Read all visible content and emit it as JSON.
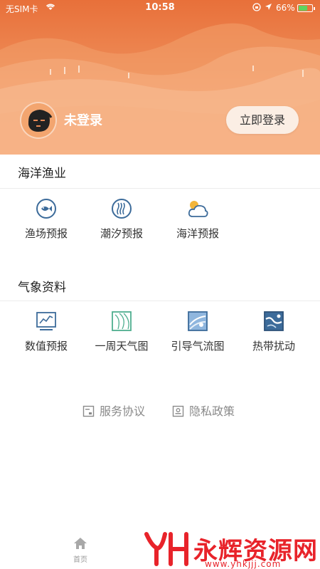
{
  "status_bar": {
    "carrier": "无SIM卡",
    "time": "10:58",
    "battery": "66%",
    "battery_level": 0.66
  },
  "profile": {
    "user_name": "未登录",
    "login_button": "立即登录"
  },
  "sections": {
    "ocean_fishery": {
      "title": "海洋渔业",
      "items": [
        {
          "label": "渔场预报",
          "icon": "fish-icon"
        },
        {
          "label": "潮汐预报",
          "icon": "tide-icon"
        },
        {
          "label": "海洋预报",
          "icon": "sun-cloud-icon"
        }
      ]
    },
    "weather_data": {
      "title": "气象资料",
      "items": [
        {
          "label": "数值预报",
          "icon": "chart-monitor-icon"
        },
        {
          "label": "一周天气图",
          "icon": "weather-map-icon"
        },
        {
          "label": "引导气流图",
          "icon": "airflow-map-icon"
        },
        {
          "label": "热带扰动",
          "icon": "tropical-map-icon"
        }
      ]
    }
  },
  "footer": {
    "service_agreement": "服务协议",
    "privacy_policy": "隐私政策"
  },
  "tabbar": {
    "home": "首页"
  },
  "watermark": {
    "brand": "永辉资源网",
    "url": "www.yhkjjj.com"
  },
  "colors": {
    "banner_orange": "#ee8b56",
    "icon_blue": "#3c6b9a",
    "watermark_red": "#e8232a"
  }
}
